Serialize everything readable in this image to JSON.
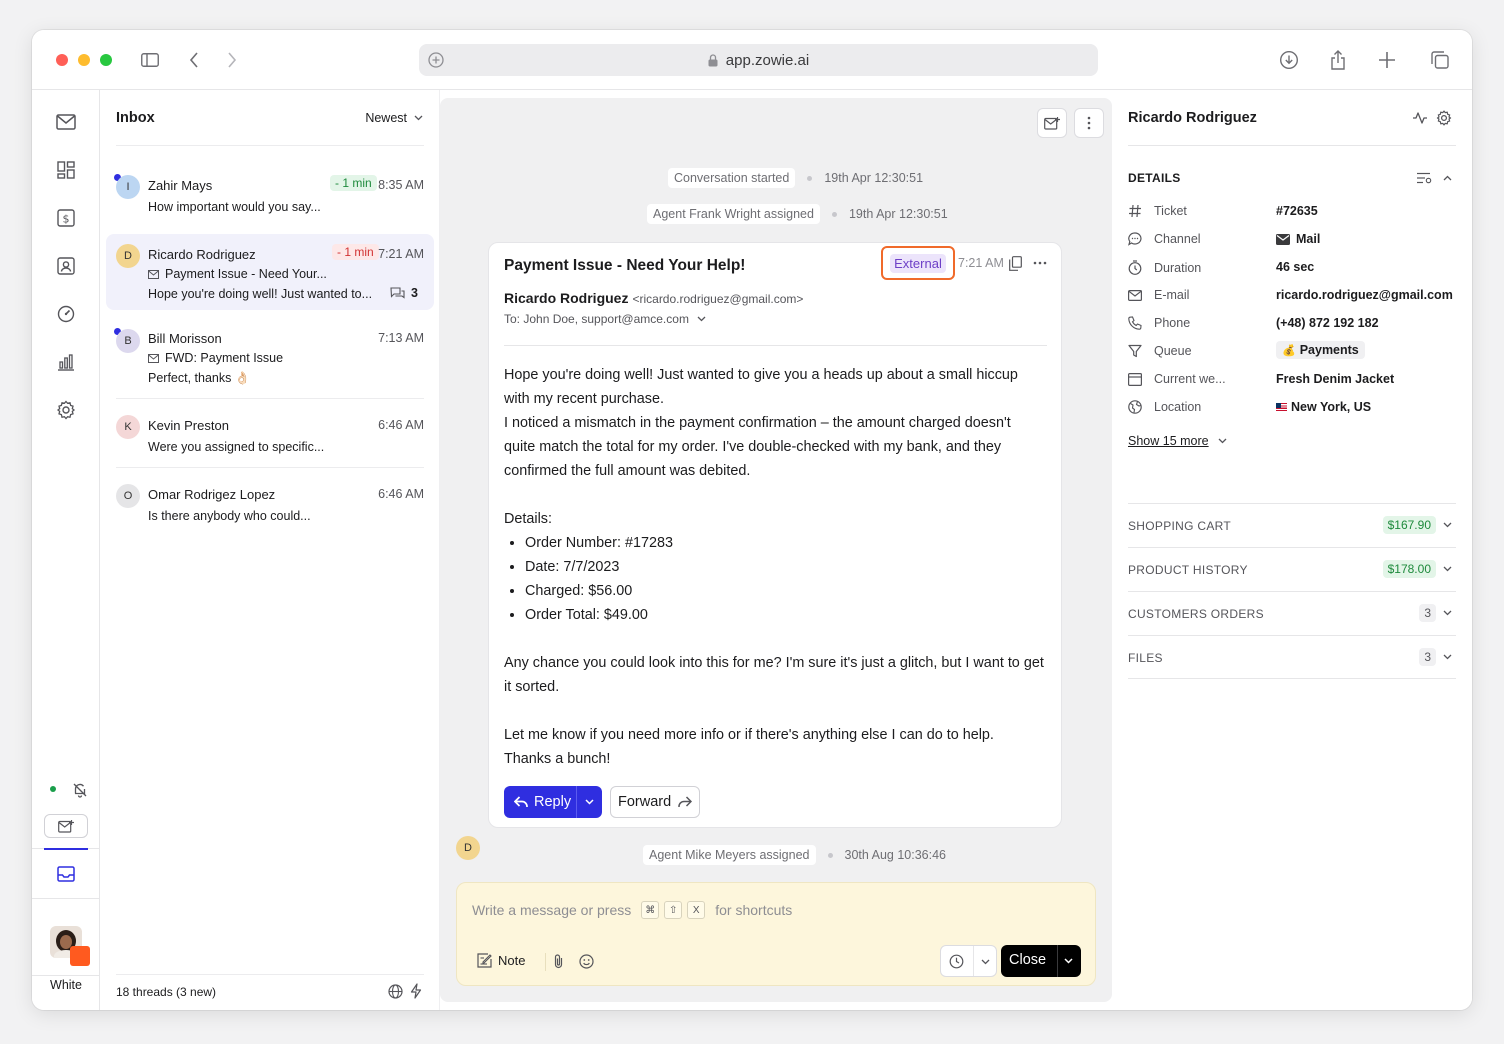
{
  "browser": {
    "url": "app.zowie.ai"
  },
  "rail": {
    "user_label": "White"
  },
  "inbox": {
    "title": "Inbox",
    "sort": "Newest",
    "footer": "18 threads (3 new)",
    "threads": [
      {
        "initial": "I",
        "name": "Zahir Mays",
        "badge": "- 1 min",
        "time": "8:35 AM",
        "preview": "How important would you say..."
      },
      {
        "initial": "D",
        "name": "Ricardo Rodriguez",
        "badge": "- 1 min",
        "time": "7:21 AM",
        "subject": "Payment Issue - Need Your...",
        "preview": "Hope you're doing well! Just wanted to...",
        "count": "3"
      },
      {
        "initial": "B",
        "name": "Bill Morisson",
        "time": "7:13 AM",
        "subject": "FWD: Payment Issue",
        "preview": "Perfect, thanks 👌🏻"
      },
      {
        "initial": "K",
        "name": "Kevin Preston",
        "time": "6:46 AM",
        "preview": "Were you assigned to specific..."
      },
      {
        "initial": "O",
        "name": "Omar Rodrigez Lopez",
        "time": "6:46 AM",
        "preview": "Is there anybody who could..."
      }
    ]
  },
  "conversation": {
    "events": [
      {
        "text": "Conversation started",
        "time": "19th Apr 12:30:51"
      },
      {
        "text": "Agent Frank Wright assigned",
        "time": "19th Apr 12:30:51"
      },
      {
        "text": "Agent Mike Meyers assigned",
        "time": "30th Aug 10:36:46"
      }
    ],
    "message": {
      "subject": "Payment Issue - Need Your Help!",
      "tag": "External",
      "time": "7:21 AM",
      "from_name": "Ricardo Rodriguez",
      "from_email": "<ricardo.rodriguez@gmail.com>",
      "to": "To: John Doe, support@amce.com",
      "p1": "Hope you're doing well! Just wanted to give you a heads up about a small hiccup with my recent purchase.",
      "p2": "I noticed a mismatch in the payment confirmation – the amount charged doesn't quite match the total for my order. I've double-checked with my bank, and they confirmed the full amount was debited.",
      "details_label": "Details:",
      "details": [
        "Order Number: #17283",
        "Date: 7/7/2023",
        "Charged: $56.00",
        "Order Total: $49.00"
      ],
      "p3": "Any chance you could look into this for me? I'm sure it's just a glitch, but I want to get it sorted.",
      "p4": "Let me know if you need more info or if there's anything else I can do to help.",
      "p5": "Thanks a bunch!",
      "sender_initial": "D"
    },
    "reply_label": "Reply",
    "forward_label": "Forward",
    "composer": {
      "placeholder_pre": "Write a message or press",
      "placeholder_post": "for shortcuts",
      "keys": [
        "⌘",
        "⇧",
        "X"
      ],
      "note_label": "Note",
      "close_label": "Close"
    }
  },
  "customer": {
    "name": "Ricardo Rodriguez",
    "details_title": "DETAILS",
    "fields": [
      {
        "label": "Ticket",
        "value": "#72635",
        "icon": "hash-icon"
      },
      {
        "label": "Channel",
        "value": "Mail",
        "icon": "chat-icon"
      },
      {
        "label": "Duration",
        "value": "46 sec",
        "icon": "timer-icon"
      },
      {
        "label": "E-mail",
        "value": "ricardo.rodriguez@gmail.com",
        "icon": "mail-icon"
      },
      {
        "label": "Phone",
        "value": "(+48) 872 192 182",
        "icon": "phone-icon"
      },
      {
        "label": "Queue",
        "value": "Payments",
        "icon": "filter-icon"
      },
      {
        "label": "Current we...",
        "value": "Fresh Denim Jacket",
        "icon": "browser-icon"
      },
      {
        "label": "Location",
        "value": "New York, US",
        "icon": "globe-icon"
      }
    ],
    "show_more": "Show 15 more",
    "sections": [
      {
        "title": "SHOPPING CART",
        "badge": "$167.90"
      },
      {
        "title": "PRODUCT HISTORY",
        "badge": "$178.00"
      },
      {
        "title": "CUSTOMERS ORDERS",
        "badge": "3"
      },
      {
        "title": "FILES",
        "badge": "3"
      }
    ]
  }
}
